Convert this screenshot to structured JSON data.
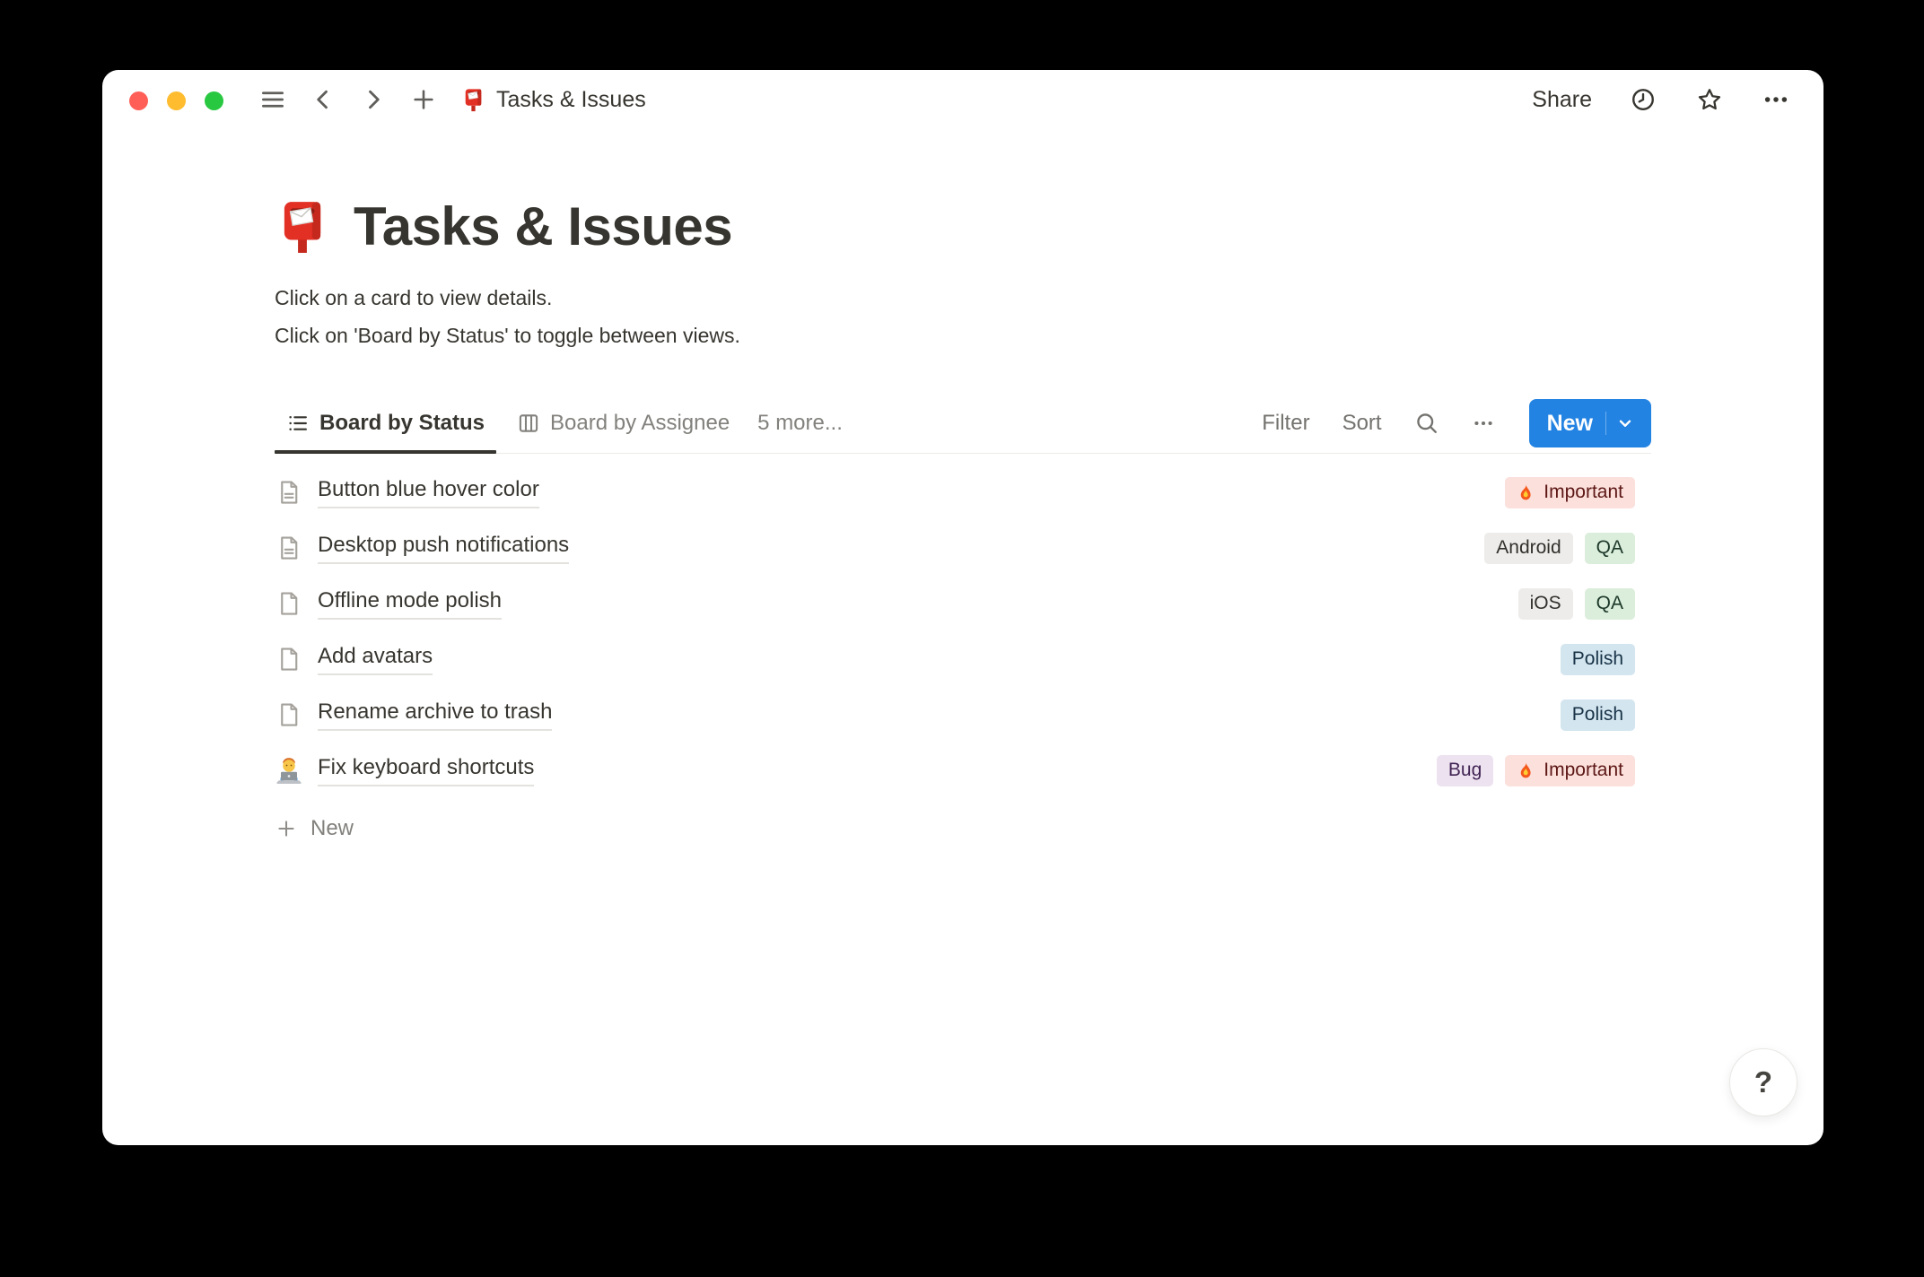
{
  "titlebar": {
    "title": "Tasks & Issues",
    "share": "Share"
  },
  "page": {
    "icon": "postbox-emoji",
    "title": "Tasks & Issues",
    "description": [
      "Click on a card to view details.",
      "Click on 'Board by Status' to toggle between views."
    ]
  },
  "views": {
    "tabs": [
      {
        "label": "Board by Status",
        "icon": "list-view-icon",
        "active": true
      },
      {
        "label": "Board by Assignee",
        "icon": "board-view-icon",
        "active": false
      },
      {
        "label": "5 more...",
        "active": false
      }
    ],
    "filter": "Filter",
    "sort": "Sort",
    "new_button": "New"
  },
  "rows": [
    {
      "icon": "page-with-text-icon",
      "title": "Button blue hover color",
      "tags": [
        {
          "label": "Important",
          "flame": true,
          "color": "red"
        }
      ]
    },
    {
      "icon": "page-with-text-icon",
      "title": "Desktop push notifications",
      "tags": [
        {
          "label": "Android",
          "color": "gray"
        },
        {
          "label": "QA",
          "color": "green"
        }
      ]
    },
    {
      "icon": "page-blank-icon",
      "title": "Offline mode polish",
      "tags": [
        {
          "label": "iOS",
          "color": "gray"
        },
        {
          "label": "QA",
          "color": "green"
        }
      ]
    },
    {
      "icon": "page-blank-icon",
      "title": "Add avatars",
      "tags": [
        {
          "label": "Polish",
          "color": "blue"
        }
      ]
    },
    {
      "icon": "page-blank-icon",
      "title": "Rename archive to trash",
      "tags": [
        {
          "label": "Polish",
          "color": "blue"
        }
      ]
    },
    {
      "icon": "technologist-emoji",
      "title": "Fix keyboard shortcuts",
      "tags": [
        {
          "label": "Bug",
          "color": "purple"
        },
        {
          "label": "Important",
          "flame": true,
          "color": "red"
        }
      ]
    }
  ],
  "new_row": "New",
  "help": "?",
  "colors": {
    "accent_blue": "#2383E2",
    "text_primary": "#37352F",
    "text_secondary": "#73726E",
    "traffic_red": "#FF5F57",
    "traffic_yellow": "#FEBC2E",
    "traffic_green": "#28C840",
    "tag_red_bg": "#FBE0DC",
    "tag_red_text": "#5D1715",
    "tag_gray_bg": "#EDECEA",
    "tag_gray_text": "#32302C",
    "tag_green_bg": "#DBEDDB",
    "tag_green_text": "#1C3829",
    "tag_blue_bg": "#D3E5EF",
    "tag_blue_text": "#183347",
    "tag_purple_bg": "#EDE3F0",
    "tag_purple_text": "#412454"
  }
}
